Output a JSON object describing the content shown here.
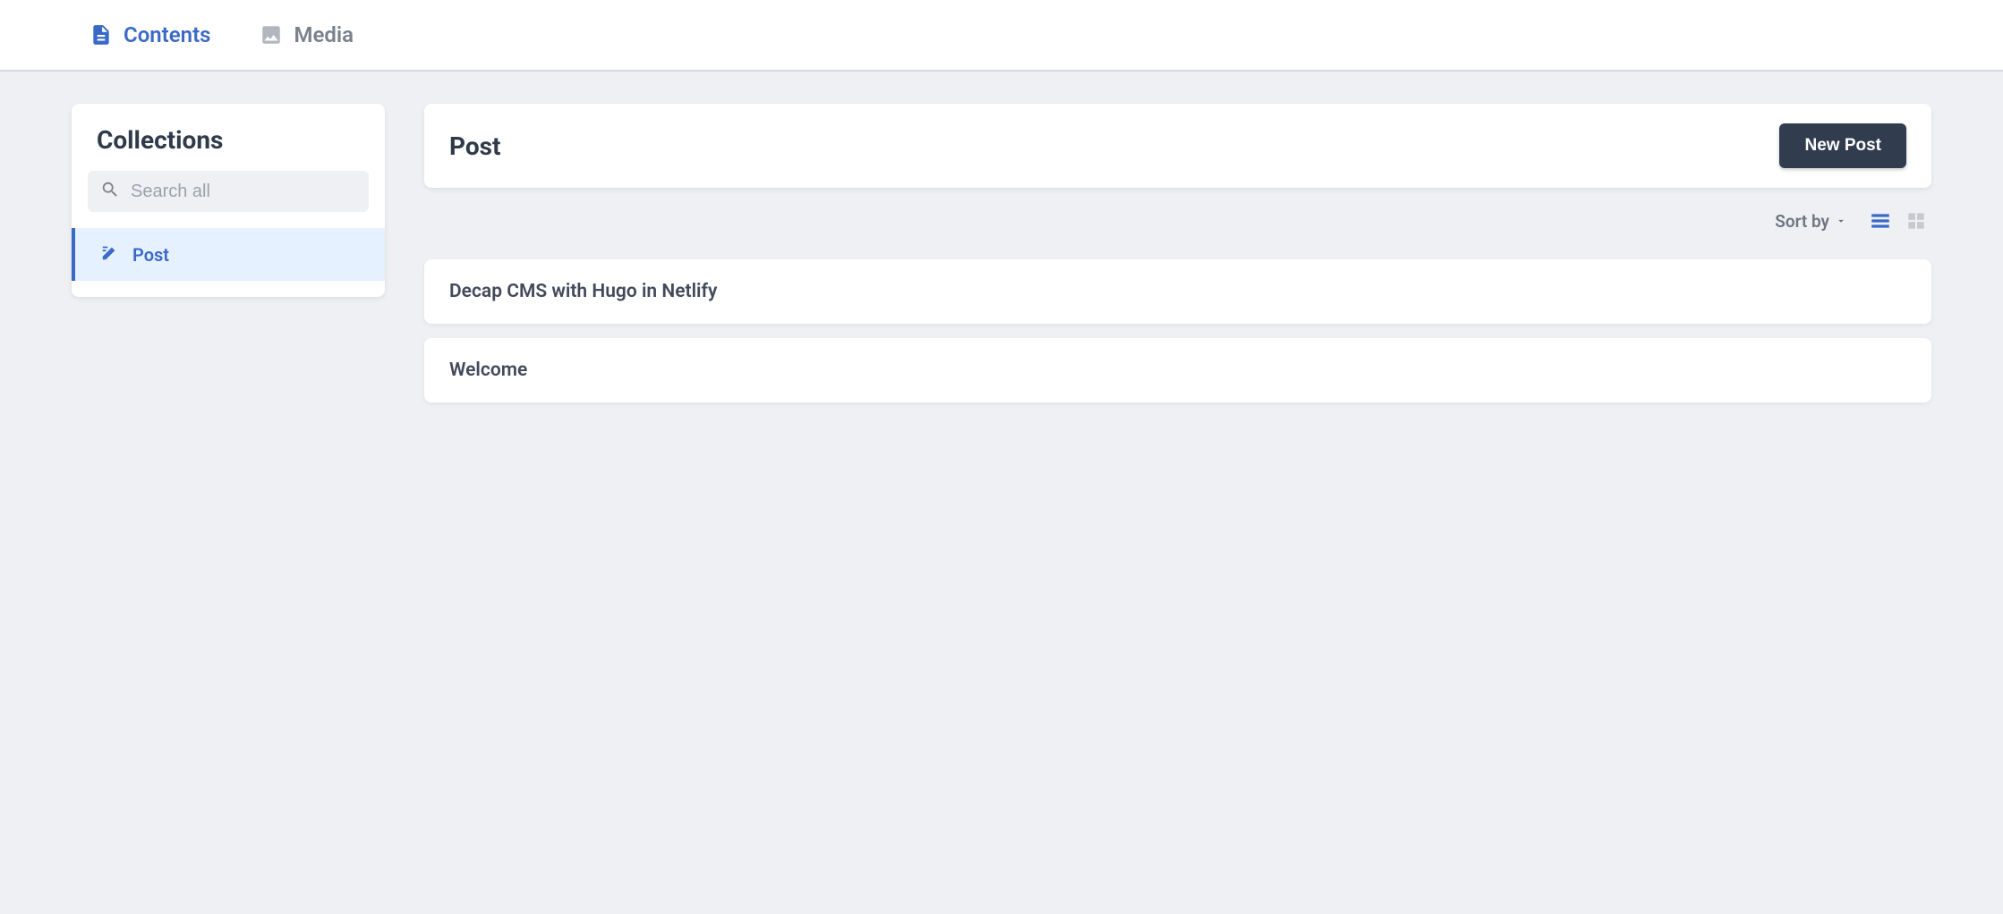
{
  "nav": {
    "contents_label": "Contents",
    "media_label": "Media"
  },
  "sidebar": {
    "title": "Collections",
    "search_placeholder": "Search all",
    "items": [
      {
        "label": "Post"
      }
    ]
  },
  "main": {
    "header_title": "Post",
    "new_button_label": "New Post",
    "sort_label": "Sort by",
    "entries": [
      {
        "title": "Decap CMS with Hugo in Netlify"
      },
      {
        "title": "Welcome"
      }
    ]
  }
}
